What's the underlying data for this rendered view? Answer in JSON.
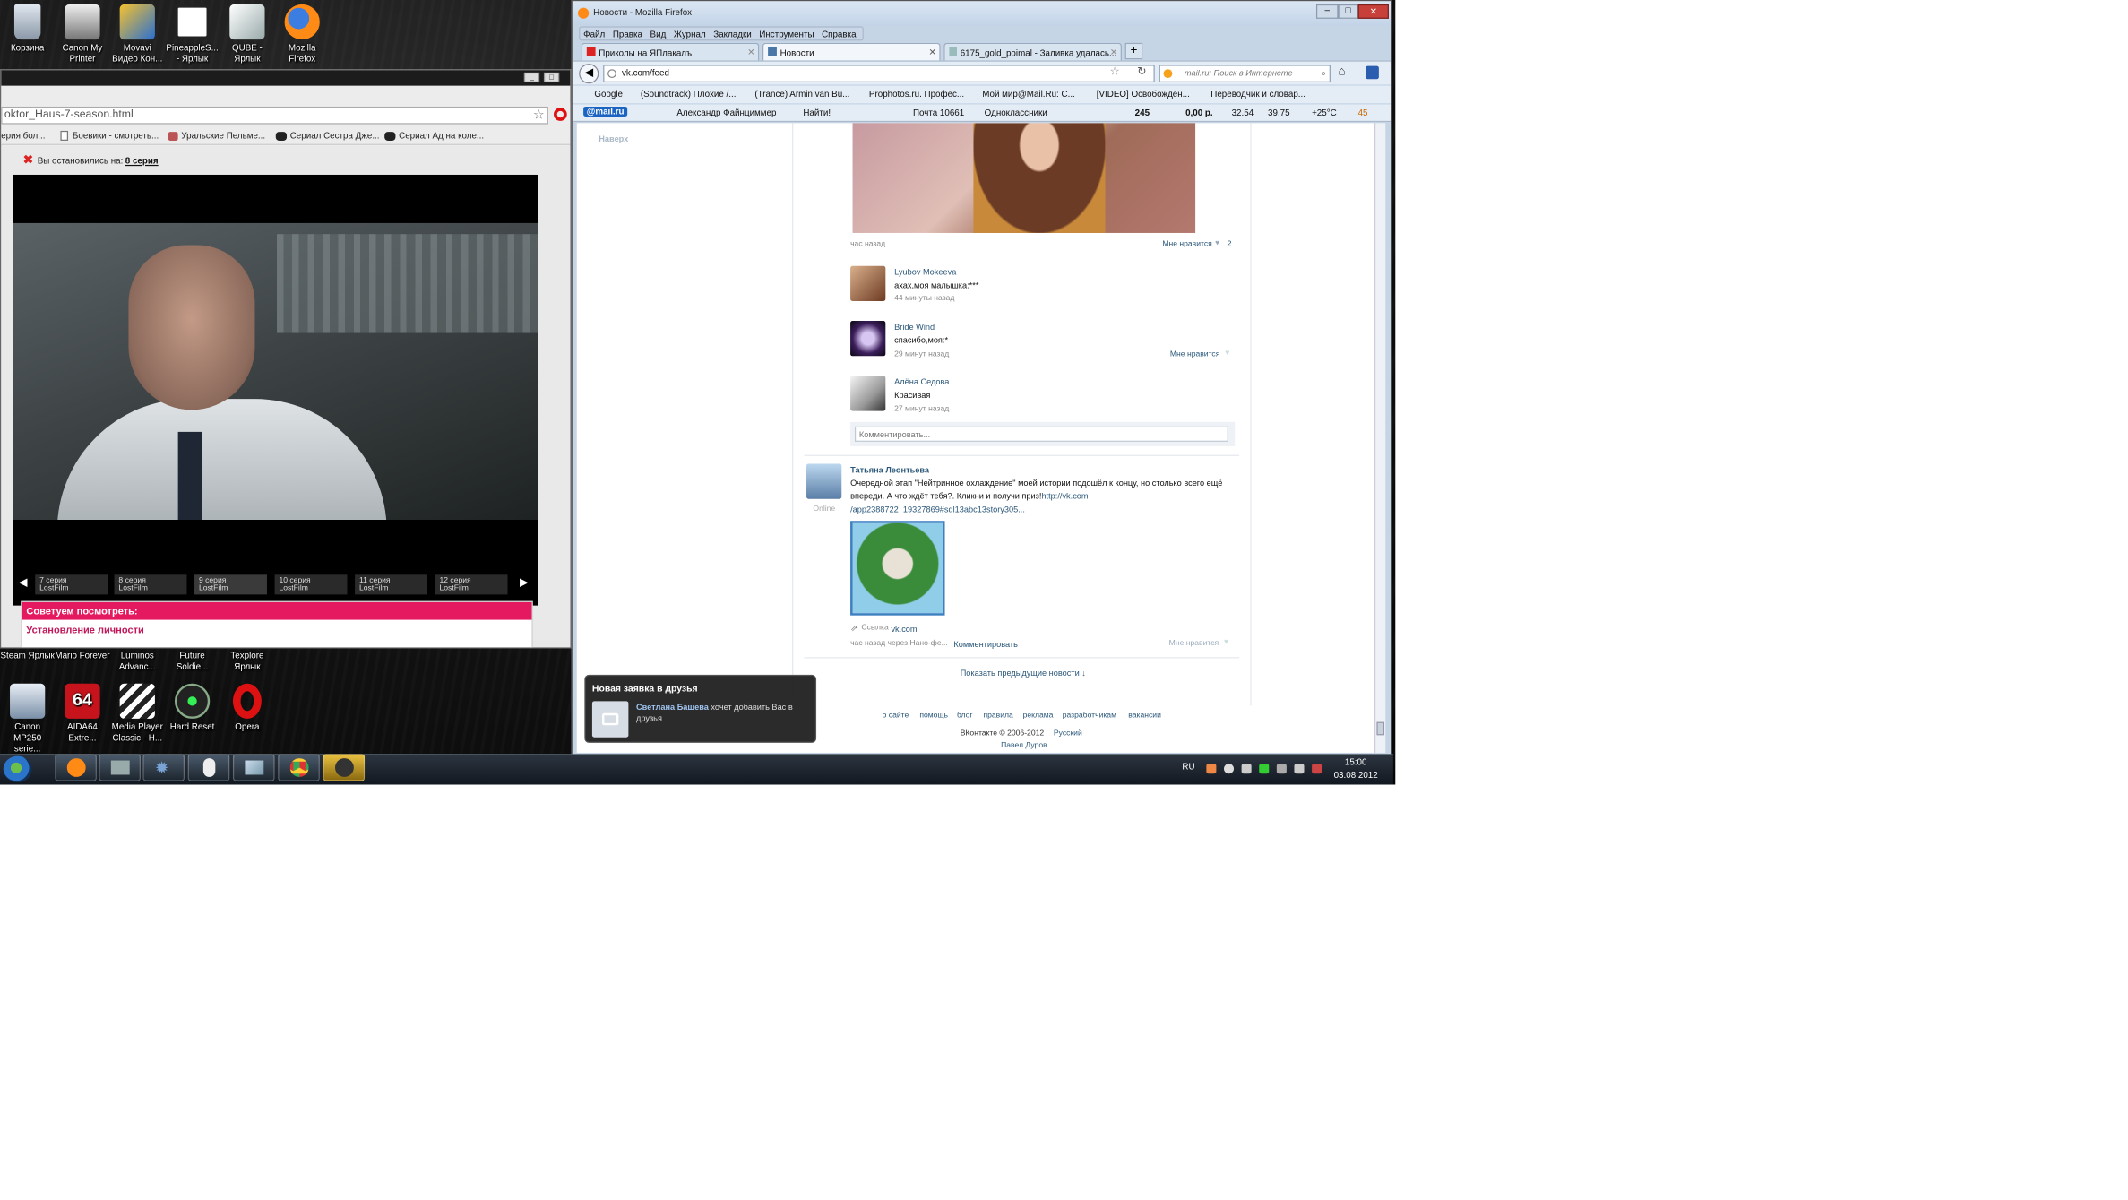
{
  "desktop": {
    "top_icons": [
      {
        "label": "Корзина"
      },
      {
        "label": "Canon My Printer"
      },
      {
        "label": "Movavi Видео Кон..."
      },
      {
        "label": "PineappleS... - Ярлык"
      },
      {
        "label": "QUBE - Ярлык"
      },
      {
        "label": "Mozilla Firefox"
      }
    ],
    "mid_icons": [
      {
        "label": "Steam Ярлык"
      },
      {
        "label": "Mario Forever"
      },
      {
        "label": "Luminos Advanc..."
      },
      {
        "label": "Future Soldie..."
      },
      {
        "label": "Texplore Ярлык"
      }
    ],
    "bottom_icons": [
      {
        "label": "Canon MP250 serie..."
      },
      {
        "label": "AIDA64 Extre..."
      },
      {
        "label": "Media Player Classic - H..."
      },
      {
        "label": "Hard Reset"
      },
      {
        "label": "Opera"
      }
    ]
  },
  "left_window": {
    "url": "oktor_Haus-7-season.html",
    "bookmarks": [
      "ерия бол...",
      "Боевики - смотреть...",
      "Уральские Пельме...",
      "Сериал Сестра Дже...",
      "Сериал Ад на коле..."
    ],
    "resume_label": "Вы остановились на:",
    "resume_link": "8 серия",
    "episodes": [
      {
        "title": "7 серия",
        "studio": "LostFilm"
      },
      {
        "title": "8 серия",
        "studio": "LostFilm"
      },
      {
        "title": "9 серия",
        "studio": "LostFilm"
      },
      {
        "title": "10 серия",
        "studio": "LostFilm"
      },
      {
        "title": "11 серия",
        "studio": "LostFilm"
      },
      {
        "title": "12 серия",
        "studio": "LostFilm"
      }
    ],
    "recommend_header": "Советуем посмотреть:",
    "recommend_item": "Установление личности"
  },
  "firefox": {
    "title": "Новости - Mozilla Firefox",
    "menu": [
      "Файл",
      "Правка",
      "Вид",
      "Журнал",
      "Закладки",
      "Инструменты",
      "Справка"
    ],
    "tabs": [
      {
        "label": "Приколы на ЯПлакалъ"
      },
      {
        "label": "Новости"
      },
      {
        "label": "6175_gold_poimal - Заливка удалась..."
      }
    ],
    "url": "vk.com/feed",
    "search_placeholder": "mail.ru: Поиск в Интернете",
    "bookmarks": [
      "Google",
      "(Soundtrack) Плохие /...",
      "(Trance) Armin van Bu...",
      "Prophotos.ru. Профес...",
      "Мой мир@Mail.Ru: С...",
      "[VIDEO] Освобожден...",
      "Переводчик и словар..."
    ],
    "mailbar": {
      "logo": "@mail.ru",
      "user": "Александр Файнциммер",
      "find": "Найти!",
      "mail": "Почта 10661",
      "ok": "Одноклассники",
      "count": "245",
      "money": "0,00 р.",
      "usd": "32.54",
      "eur": "39.75",
      "temp": "+25°C",
      "extra": "45"
    }
  },
  "vk": {
    "back_to_top": "Наверх",
    "post_time": "час назад",
    "post_like": "Мне нравится",
    "post_like_count": "2",
    "comments": [
      {
        "name": "Lyubov Mokeeva",
        "text": "ахах,моя малышка:***",
        "time": "44 минуты назад",
        "like": ""
      },
      {
        "name": "Bride Wind",
        "text": "спасибо,моя:*",
        "time": "29 минут назад",
        "like": "Мне нравится"
      },
      {
        "name": "Алёна Седова",
        "text": "Красивая",
        "time": "27 минут назад",
        "like": ""
      }
    ],
    "comment_placeholder": "Комментировать...",
    "post2": {
      "author": "Татьяна Леонтьева",
      "status": "Online",
      "text1": "Очередной этап \"Нейтринное охлаждение\" моей истории подошёл к концу, но столько всего ещё",
      "text2": "впереди. А что ждёт тебя?. Кликни и получи приз!",
      "link": "http://vk.com",
      "link2": "/app2388722_19327869#sql13abc13story305...",
      "attach_label": "Ссылка",
      "attach_link": "vk.com",
      "meta": "час назад через Нано-фе...",
      "comment_action": "Комментировать",
      "like": "Мне нравится"
    },
    "show_more": "Показать предыдущие новости ↓",
    "footer_links": [
      "о сайте",
      "помощь",
      "блог",
      "правила",
      "реклама",
      "разработчикам",
      "вакансии"
    ],
    "copyright": "ВКонтакте © 2006-2012",
    "lang": "Русский",
    "author_link": "Павел Дуров"
  },
  "notification": {
    "title": "Новая заявка в друзья",
    "name": "Светлана Башева",
    "text": "хочет добавить Вас в друзья"
  },
  "taskbar": {
    "lang": "RU",
    "time": "15:00",
    "date": "03.08.2012"
  }
}
